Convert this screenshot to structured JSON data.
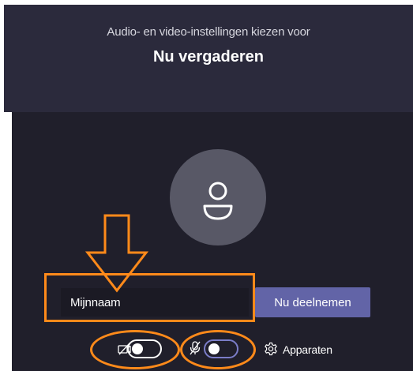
{
  "header": {
    "pre_title": "Audio- en video-instellingen kiezen voor",
    "title": "Nu vergaderen"
  },
  "name_input": {
    "value": "Mijnnaam",
    "placeholder": ""
  },
  "join_button": {
    "label": "Nu deelnemen"
  },
  "controls": {
    "camera": {
      "icon": "camera-off-icon",
      "state": "off"
    },
    "microphone": {
      "icon": "microphone-off-icon",
      "state": "off"
    },
    "devices": {
      "icon": "gear-icon",
      "label": "Apparaten"
    }
  },
  "annotations": {
    "color": "#ff8a1a"
  },
  "colors": {
    "header_bg": "#2b2a3c",
    "panel_bg": "#201f2b",
    "accent": "#6264a7"
  }
}
